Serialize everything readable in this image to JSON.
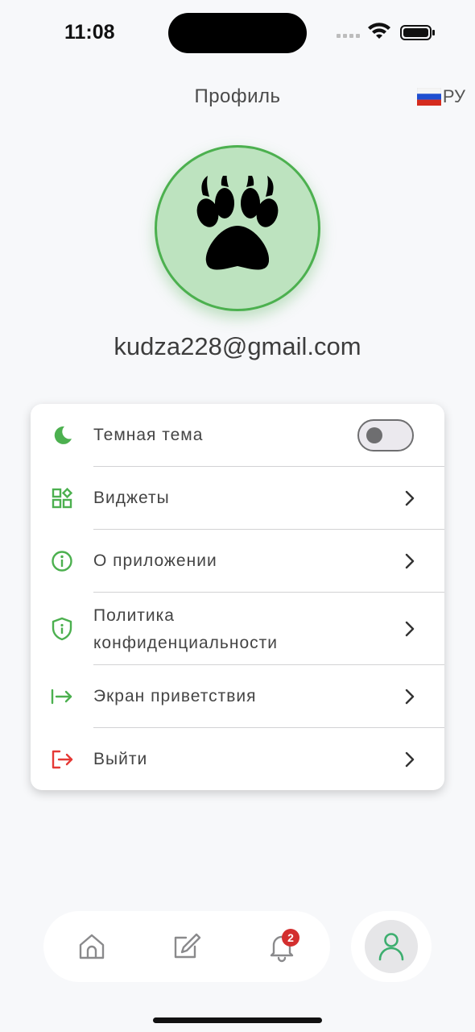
{
  "status_bar": {
    "time": "11:08"
  },
  "header": {
    "title": "Профиль",
    "language_flag": "🇷🇺",
    "language_code": "РУ"
  },
  "profile": {
    "avatar_icon": "paw-icon",
    "email": "kudza228@gmail.com"
  },
  "settings": {
    "dark_theme": {
      "label": "Темная тема",
      "icon": "moon-icon",
      "enabled": false
    },
    "items": [
      {
        "label": "Виджеты",
        "icon": "widgets-icon"
      },
      {
        "label": "О приложении",
        "icon": "info-icon"
      },
      {
        "label_line1": "Политика",
        "label_line2": "конфиденциальности",
        "icon": "shield-icon"
      },
      {
        "label": "Экран приветствия",
        "icon": "arrow-right-bar-icon"
      },
      {
        "label": "Выйти",
        "icon": "logout-icon"
      }
    ]
  },
  "bottom_nav": {
    "items": [
      "home-icon",
      "edit-icon",
      "bell-icon",
      "profile-icon"
    ],
    "notifications_badge": "2",
    "active": "profile-icon"
  },
  "colors": {
    "accent": "#4cb04f",
    "danger": "#e53935",
    "badge": "#d32f2f",
    "avatar_bg": "#bde3bf"
  }
}
